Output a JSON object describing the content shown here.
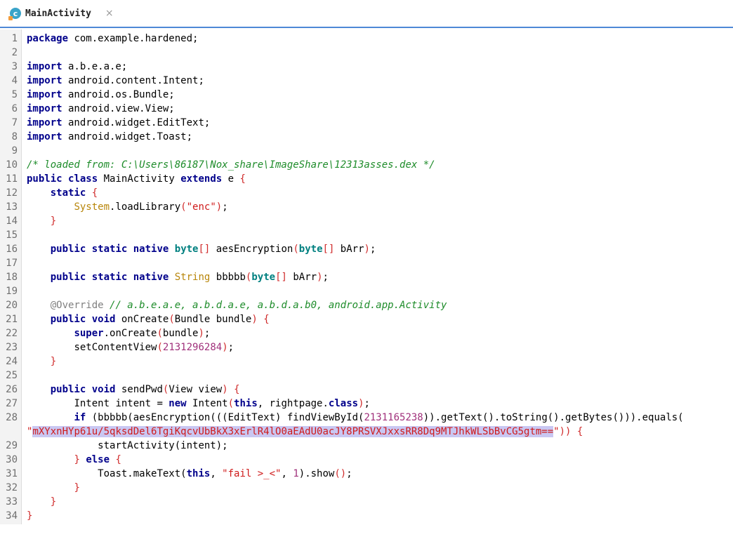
{
  "tab": {
    "title": "MainActivity",
    "icon_letter": "c",
    "close_glyph": "×"
  },
  "line_numbers": [
    "1",
    "2",
    "3",
    "4",
    "5",
    "6",
    "7",
    "8",
    "9",
    "10",
    "11",
    "12",
    "13",
    "14",
    "15",
    "16",
    "17",
    "18",
    "19",
    "20",
    "21",
    "22",
    "23",
    "24",
    "25",
    "26",
    "27",
    "28",
    "29",
    "30",
    "31",
    "32",
    "33",
    "34"
  ],
  "code": {
    "l1": {
      "kw": "package",
      "rest": " com.example.hardened;"
    },
    "imports": [
      {
        "kw": "import",
        "rest": " a.b.e.a.e;"
      },
      {
        "kw": "import",
        "rest": " android.content.Intent;"
      },
      {
        "kw": "import",
        "rest": " android.os.Bundle;"
      },
      {
        "kw": "import",
        "rest": " android.view.View;"
      },
      {
        "kw": "import",
        "rest": " android.widget.EditText;"
      },
      {
        "kw": "import",
        "rest": " android.widget.Toast;"
      }
    ],
    "l10": "/* loaded from: C:\\Users\\86187\\Nox_share\\ImageShare\\12313asses.dex */",
    "l11": {
      "kw1": "public",
      "kw2": "class",
      "name": " MainActivity ",
      "kw3": "extends",
      "rest": " e ",
      "brace": "{"
    },
    "l12": {
      "kw": "static",
      "brace": "{"
    },
    "l13": {
      "cls": "System",
      "mid": ".loadLibrary",
      "open": "(",
      "str": "\"enc\"",
      "close": ")",
      "end": ";"
    },
    "l16": {
      "kw1": "public",
      "kw2": "static",
      "kw3": "native",
      "type": "byte",
      "brackets": "[]",
      "name": " aesEncryption",
      "open": "(",
      "ptype": "byte",
      "pbr": "[]",
      "param": " bArr",
      "close": ")",
      "end": ";"
    },
    "l18": {
      "kw1": "public",
      "kw2": "static",
      "kw3": "native",
      "type": "String",
      "name": " bbbbb",
      "open": "(",
      "ptype": "byte",
      "pbr": "[]",
      "param": " bArr",
      "close": ")",
      "end": ";"
    },
    "l20": {
      "ann": "@Override",
      "cmt": "// a.b.e.a.e, a.b.d.a.e, a.b.d.a.b0, android.app.Activity"
    },
    "l21": {
      "kw1": "public",
      "kw2": "void",
      "name": " onCreate",
      "open": "(",
      "param": "Bundle bundle",
      "close": ")",
      "brace": "{"
    },
    "l22": {
      "kw": "super",
      "rest": ".onCreate",
      "open": "(",
      "param": "bundle",
      "close": ")",
      "end": ";"
    },
    "l23": {
      "rest": "setContentView",
      "open": "(",
      "num": "2131296284",
      "close": ")",
      "end": ";"
    },
    "l26": {
      "kw1": "public",
      "kw2": "void",
      "name": " sendPwd",
      "open": "(",
      "param": "View view",
      "close": ")",
      "brace": "{"
    },
    "l27": {
      "a": "Intent intent = ",
      "kw": "new",
      "b": " Intent",
      "open": "(",
      "kw2": "this",
      "c": ", rightpage.",
      "kw3": "class",
      "close": ")",
      "end": ";"
    },
    "l28": {
      "kw": "if",
      "a": " (bbbbb(aesEncryption(((EditText) findViewById(",
      "num": "2131165238",
      "b": ")).getText().toString().getBytes())).equals("
    },
    "l28b": {
      "q1": "\"",
      "str": "mXYxnHYp61u/5qksdDel6TgiKqcvUbBkX3xErlR4lO0aEAdU0acJY8PRSVXJxxsRR8Dq9MTJhkWLSbBvCG5gtm==",
      "q2": "\"",
      "rest": ")) ",
      "brace": "{"
    },
    "l29": "startActivity(intent);",
    "l30": {
      "brace1": "}",
      "kw": "else",
      "brace2": "{"
    },
    "l31": {
      "a": "Toast.makeText(",
      "kw": "this",
      "b": ", ",
      "str": "\"fail >_<\"",
      "c": ", ",
      "num": "1",
      "d": ").show",
      "open": "(",
      "close": ")",
      "end": ";"
    },
    "close_brace": "}"
  }
}
